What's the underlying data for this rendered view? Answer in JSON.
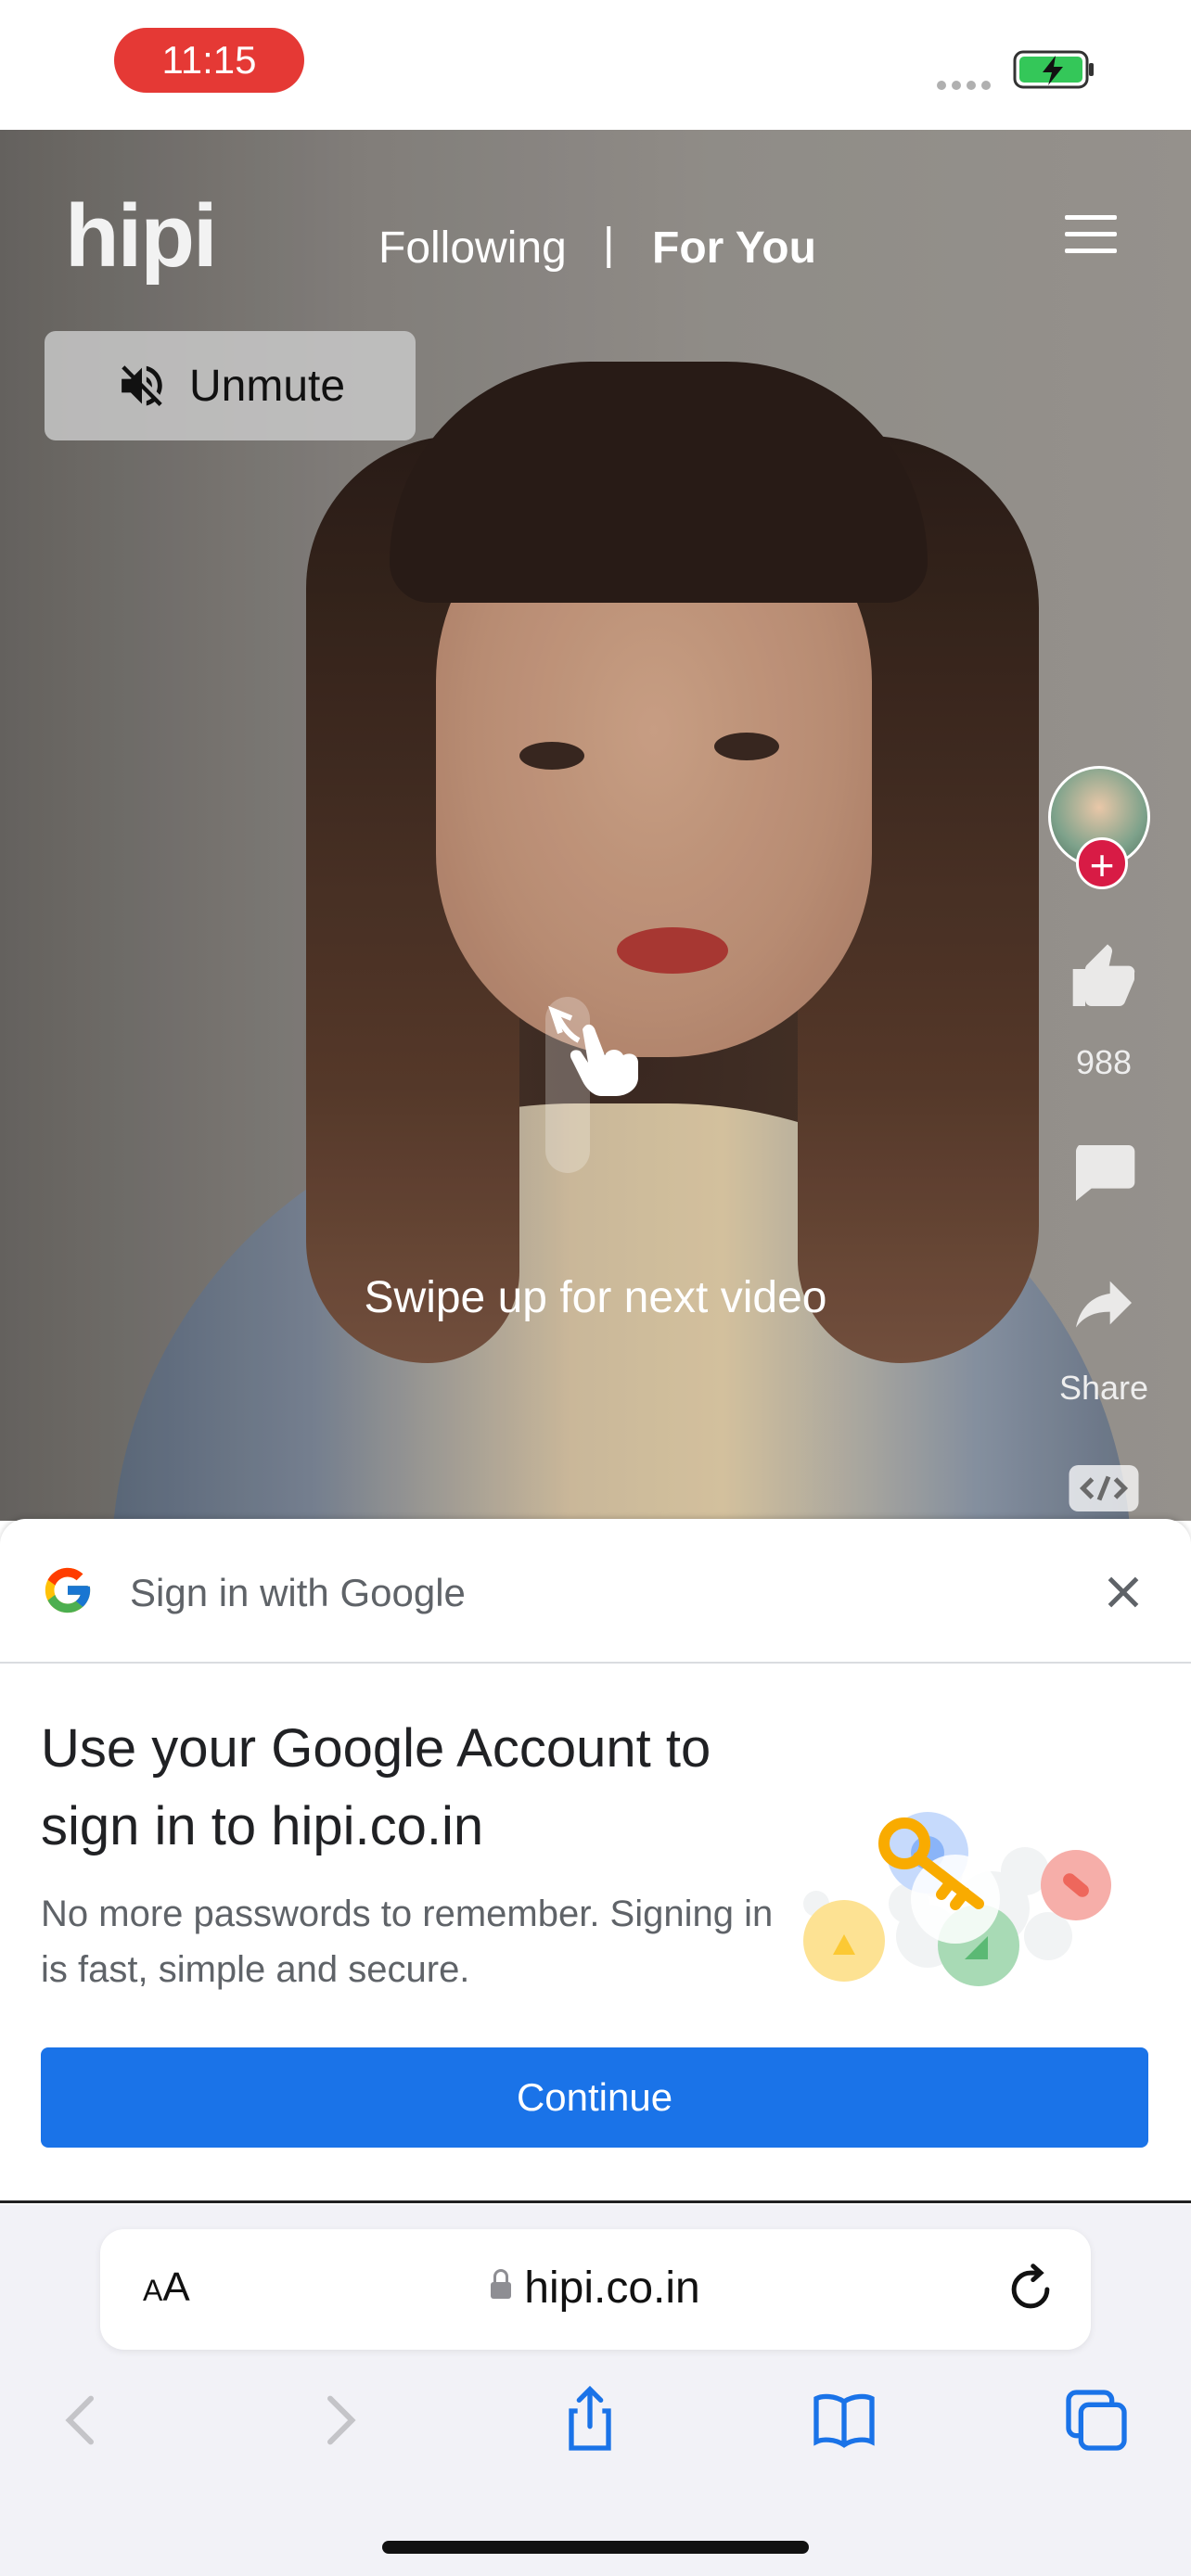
{
  "status_bar": {
    "time": "11:15"
  },
  "app": {
    "logo": "hipi",
    "tabs": {
      "following": "Following",
      "separator": "|",
      "for_you": "For You"
    },
    "unmute_label": "Unmute",
    "like_count": "988",
    "share_label": "Share",
    "swipe_hint": "Swipe up for next video"
  },
  "google_sheet": {
    "title": "Sign in with Google",
    "heading": "Use your Google Account to sign in to hipi.co.in",
    "subtext": "No more passwords to remember. Signing in is fast, simple and secure.",
    "continue_label": "Continue"
  },
  "safari": {
    "aa_label": "AA",
    "url": "hipi.co.in"
  },
  "colors": {
    "status_time_pill": "#e53935",
    "google_blue": "#1a73e8",
    "follow_badge": "#d81b45"
  },
  "icons": [
    "battery-charging-icon",
    "menu-icon",
    "mute-icon",
    "like-icon",
    "comment-icon",
    "share-icon",
    "embed-icon",
    "swipe-hand-icon",
    "google-logo-icon",
    "close-icon",
    "lock-icon",
    "reload-icon",
    "back-icon",
    "forward-icon",
    "share-sheet-icon",
    "bookmarks-icon",
    "tabs-icon"
  ]
}
